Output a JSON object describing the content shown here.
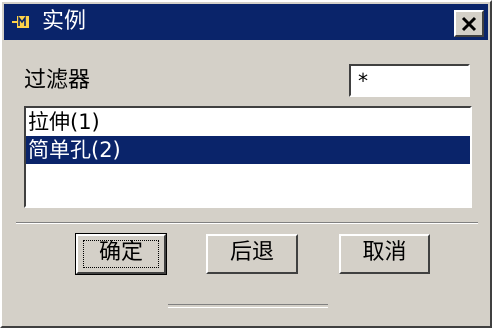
{
  "window": {
    "title": "实例",
    "icon": "expression-icon",
    "close_label": "✕"
  },
  "filter": {
    "label": "过滤器",
    "value": "*"
  },
  "list": {
    "items": [
      {
        "label": "拉伸(1)",
        "selected": false
      },
      {
        "label": "简单孔(2)",
        "selected": true
      }
    ]
  },
  "buttons": {
    "ok_label": "确定",
    "back_label": "后退",
    "cancel_label": "取消"
  },
  "colors": {
    "titlebar": "#0a246a",
    "selection": "#0a246a",
    "face": "#d4d0c8"
  }
}
